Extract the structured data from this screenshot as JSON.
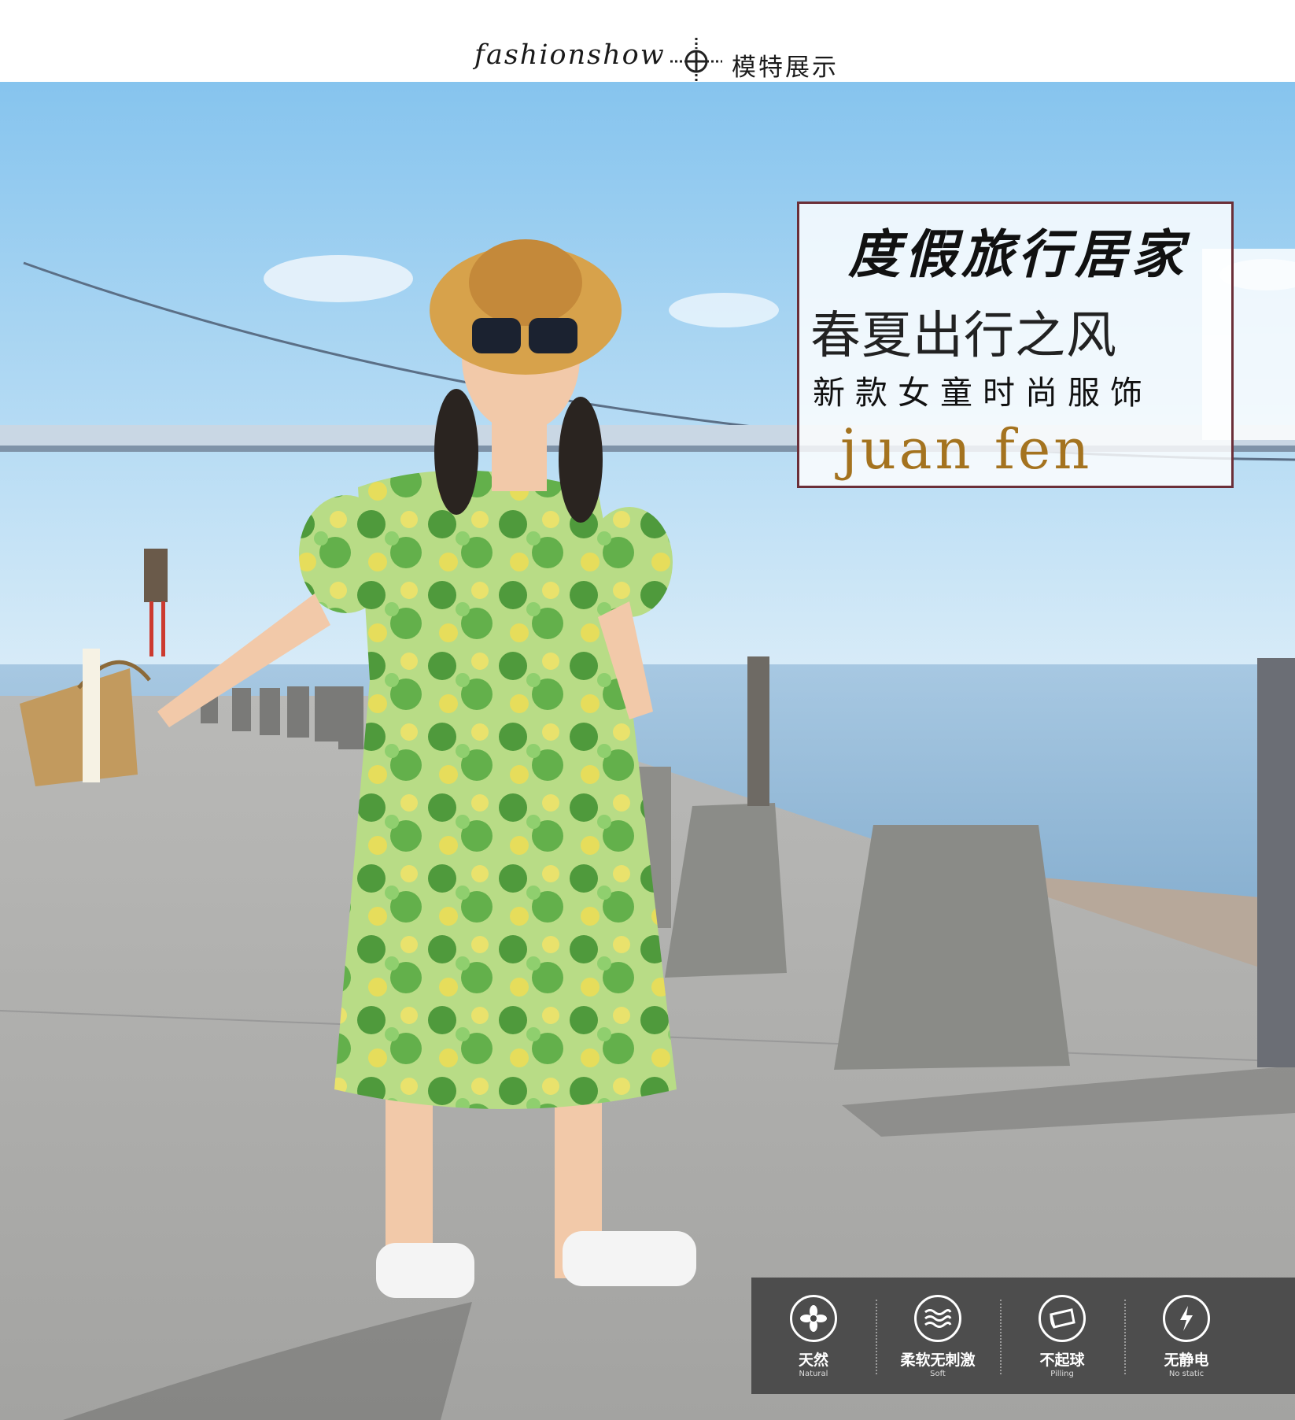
{
  "header": {
    "title_en": "fashionshow",
    "title_cn": "模特展示"
  },
  "banner": {
    "script_line": "度假旅行居家",
    "headline": "春夏出行之风",
    "subline": "新款女童时尚服饰",
    "brand": "juan fen"
  },
  "features": [
    {
      "label_cn": "天然",
      "label_en": "Natural",
      "icon": "flower-icon"
    },
    {
      "label_cn": "柔软无刺激",
      "label_en": "Soft",
      "icon": "wave-icon"
    },
    {
      "label_cn": "不起球",
      "label_en": "Pilling",
      "icon": "fabric-icon"
    },
    {
      "label_cn": "无静电",
      "label_en": "No static",
      "icon": "lightning-icon"
    }
  ],
  "colors": {
    "frame": "#6b2f38",
    "brand": "#a4731f",
    "feature_bar": "#464646",
    "sky_top": "#8cc7ef",
    "sea": "#8fb8d8"
  }
}
